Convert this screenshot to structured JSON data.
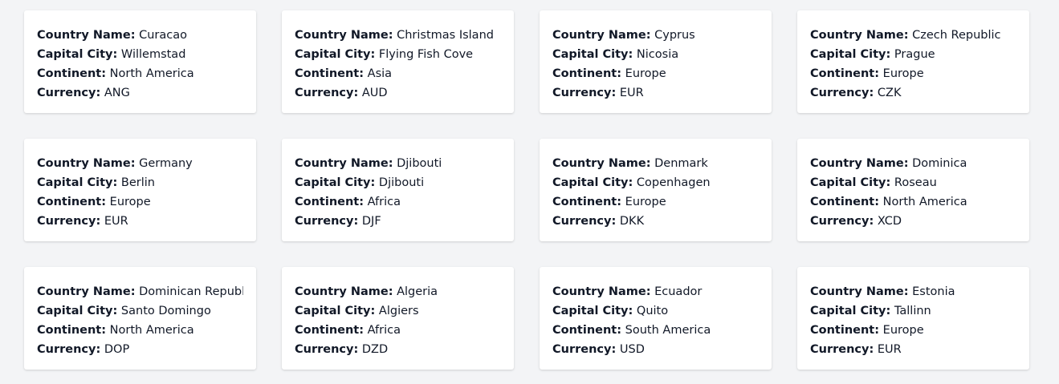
{
  "labels": {
    "name": "Country Name:",
    "capital": "Capital City:",
    "continent": "Continent:",
    "currency": "Currency:"
  },
  "countries": [
    {
      "name": "Curacao",
      "capital": "Willemstad",
      "continent": "North America",
      "currency": "ANG"
    },
    {
      "name": "Christmas Island",
      "capital": "Flying Fish Cove",
      "continent": "Asia",
      "currency": "AUD"
    },
    {
      "name": "Cyprus",
      "capital": "Nicosia",
      "continent": "Europe",
      "currency": "EUR"
    },
    {
      "name": "Czech Republic",
      "capital": "Prague",
      "continent": "Europe",
      "currency": "CZK"
    },
    {
      "name": "Germany",
      "capital": "Berlin",
      "continent": "Europe",
      "currency": "EUR"
    },
    {
      "name": "Djibouti",
      "capital": "Djibouti",
      "continent": "Africa",
      "currency": "DJF"
    },
    {
      "name": "Denmark",
      "capital": "Copenhagen",
      "continent": "Europe",
      "currency": "DKK"
    },
    {
      "name": "Dominica",
      "capital": "Roseau",
      "continent": "North America",
      "currency": "XCD"
    },
    {
      "name": "Dominican Republic",
      "capital": "Santo Domingo",
      "continent": "North America",
      "currency": "DOP"
    },
    {
      "name": "Algeria",
      "capital": "Algiers",
      "continent": "Africa",
      "currency": "DZD"
    },
    {
      "name": "Ecuador",
      "capital": "Quito",
      "continent": "South America",
      "currency": "USD"
    },
    {
      "name": "Estonia",
      "capital": "Tallinn",
      "continent": "Europe",
      "currency": "EUR"
    }
  ]
}
